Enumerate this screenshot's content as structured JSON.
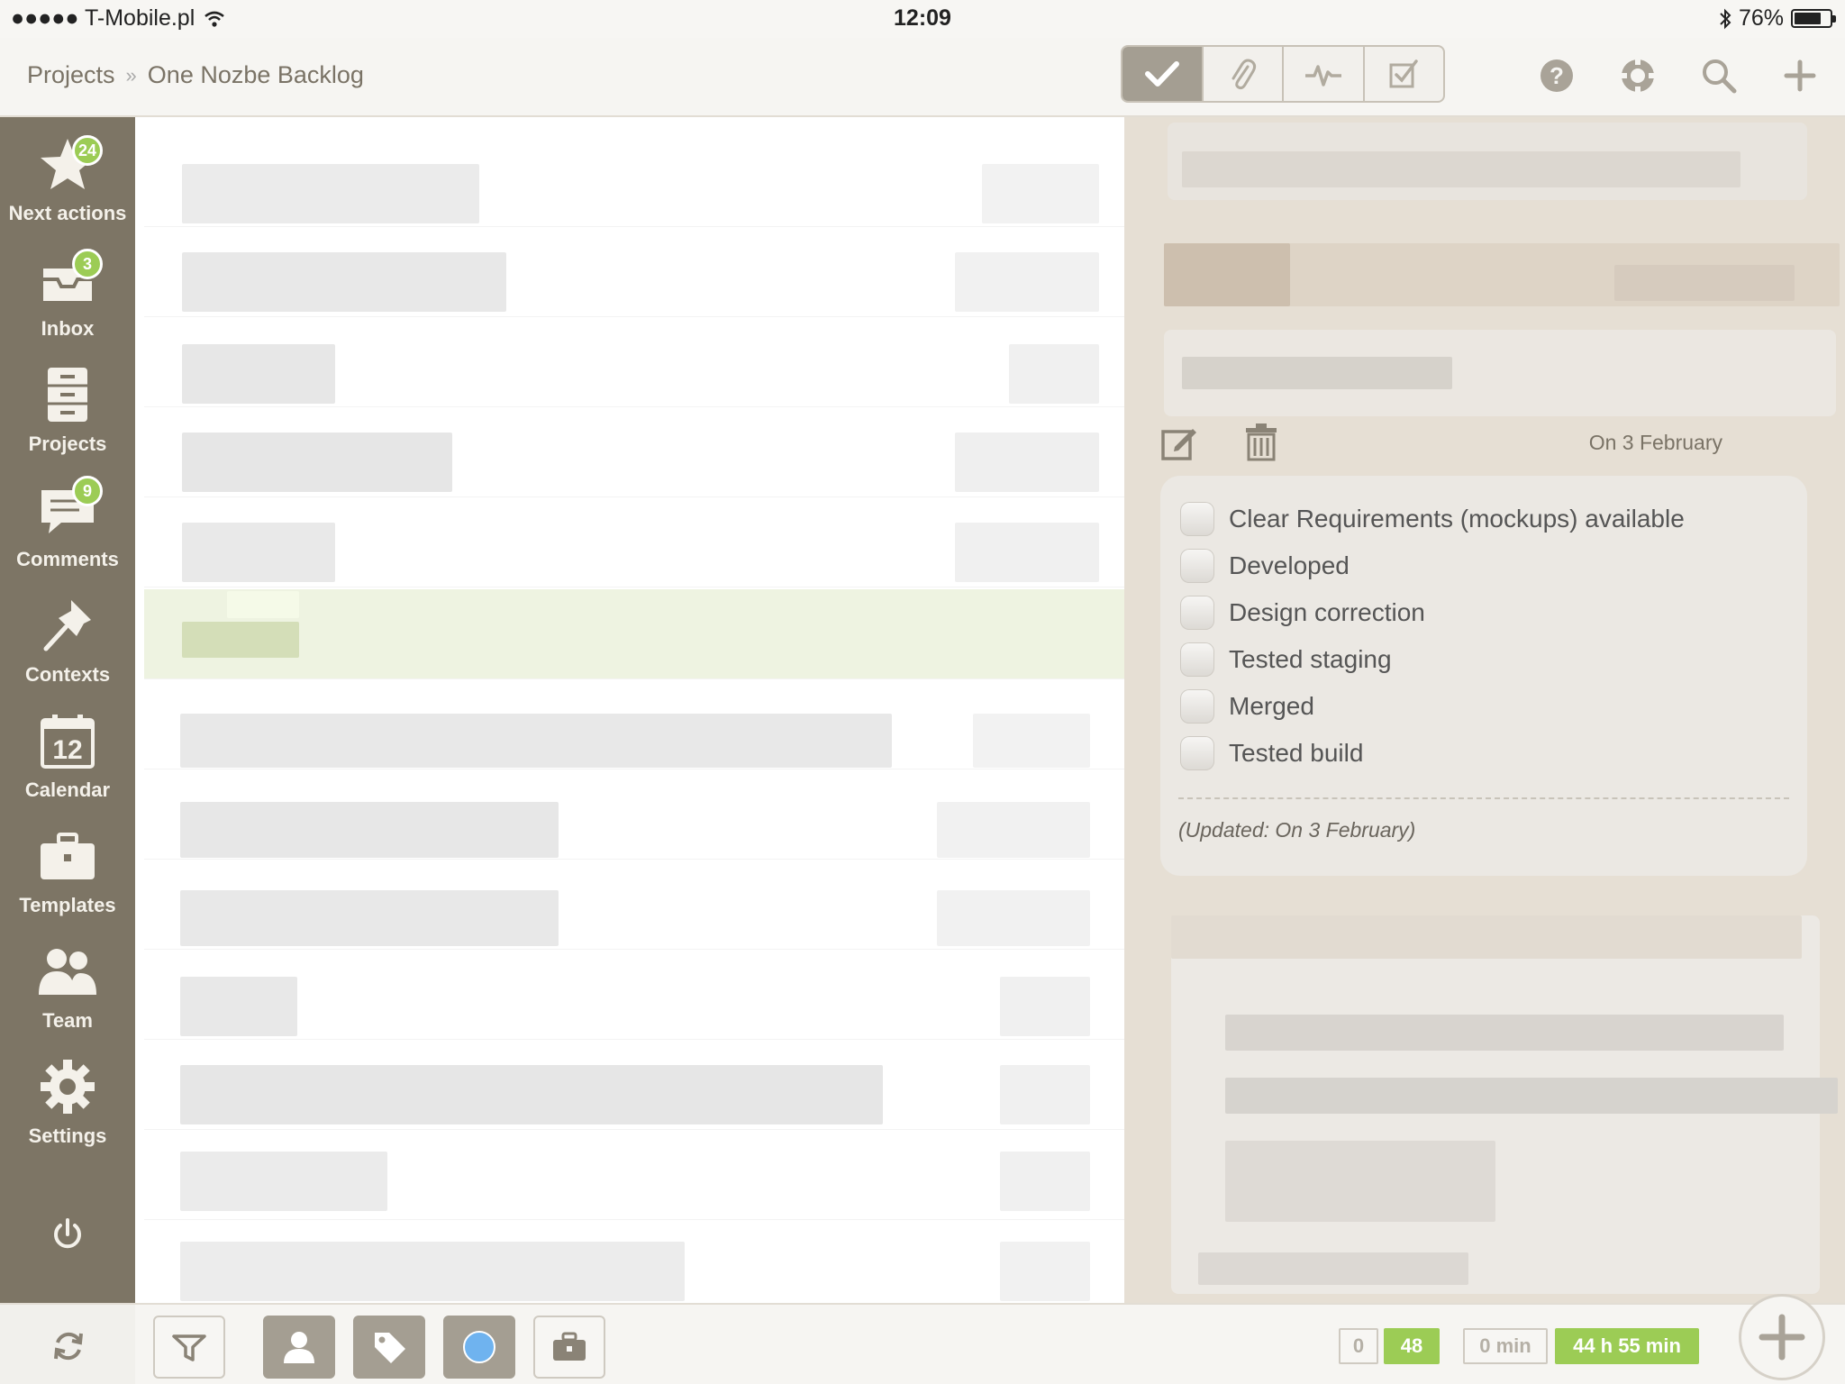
{
  "status_bar": {
    "carrier": "●●●●● T-Mobile.pl",
    "time": "12:09",
    "battery": "76%"
  },
  "breadcrumb": {
    "root": "Projects",
    "separator": "»",
    "current": "One Nozbe Backlog"
  },
  "view_segments": [
    "check-icon",
    "paperclip-icon",
    "activity-icon",
    "checklist-icon"
  ],
  "top_actions": [
    "help-icon",
    "lifebuoy-icon",
    "search-icon",
    "plus-icon"
  ],
  "sidebar": {
    "items": [
      {
        "label": "Next actions",
        "icon": "star-icon",
        "badge": "24"
      },
      {
        "label": "Inbox",
        "icon": "inbox-icon",
        "badge": "3"
      },
      {
        "label": "Projects",
        "icon": "file-cabinet-icon",
        "badge": ""
      },
      {
        "label": "Comments",
        "icon": "speech-bubble-icon",
        "badge": "9"
      },
      {
        "label": "Contexts",
        "icon": "pin-icon",
        "badge": ""
      },
      {
        "label": "Calendar",
        "icon": "calendar-icon",
        "badge": "",
        "day": "12"
      },
      {
        "label": "Templates",
        "icon": "briefcase-icon",
        "badge": ""
      },
      {
        "label": "Team",
        "icon": "people-icon",
        "badge": ""
      },
      {
        "label": "Settings",
        "icon": "gear-icon",
        "badge": ""
      }
    ]
  },
  "detail": {
    "comment_date": "On 3 February",
    "checklist": [
      "Clear Requirements (mockups) available",
      "Developed",
      "Design correction",
      "Tested staging",
      "Merged",
      "Tested build"
    ],
    "updated": "(Updated: On 3 February)"
  },
  "bottom_bar": {
    "counters": {
      "a": "0",
      "b": "48",
      "c": "0 min",
      "d": "44 h 55 min"
    }
  },
  "colors": {
    "sidebar": "#7d7565",
    "accent_green": "#9ccc55",
    "detail_panel": "#e6dfd4"
  }
}
